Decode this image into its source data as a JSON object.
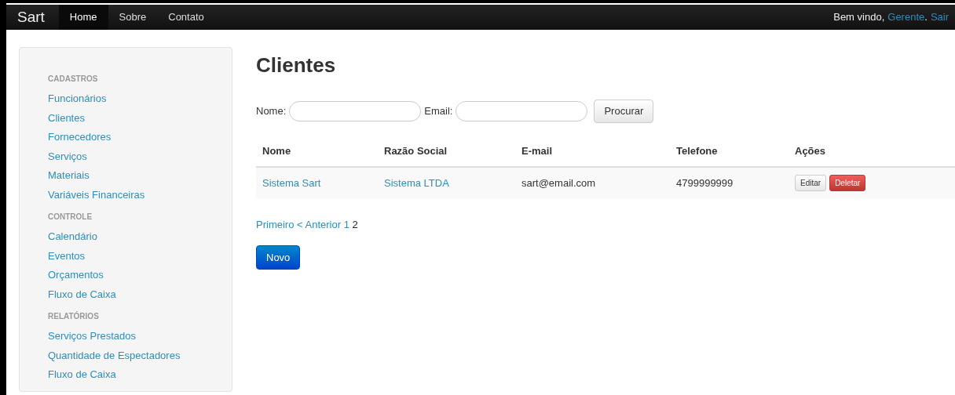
{
  "navbar": {
    "brand": "Sart",
    "items": [
      {
        "label": "Home",
        "selected": true
      },
      {
        "label": "Sobre",
        "selected": false
      },
      {
        "label": "Contato",
        "selected": false
      }
    ],
    "greeting": "Bem vindo,",
    "user": "Gerente",
    "separator": ".",
    "logout": "Sair"
  },
  "sidebar": {
    "sections": [
      {
        "header": "CADASTROS",
        "items": [
          "Funcionários",
          "Clientes",
          "Fornecedores",
          "Serviços",
          "Materiais",
          "Variáveis Financeiras"
        ]
      },
      {
        "header": "CONTROLE",
        "items": [
          "Calendário",
          "Eventos",
          "Orçamentos",
          "Fluxo de Caixa"
        ]
      },
      {
        "header": "RELATÓRIOS",
        "items": [
          "Serviços Prestados",
          "Quantidade de Espectadores",
          "Fluxo de Caixa"
        ]
      }
    ]
  },
  "page_title": "Clientes",
  "search": {
    "fields": [
      {
        "label": "Nome:"
      },
      {
        "label": "Email:"
      }
    ],
    "button": "Procurar"
  },
  "table": {
    "columns": [
      "Nome",
      "Razão Social",
      "E-mail",
      "Telefone",
      "Ações"
    ],
    "rows": [
      {
        "nome": "Sistema Sart",
        "razao_social": "Sistema LTDA",
        "email": "sart@email.com",
        "telefone": "4799999999",
        "actions": [
          "Editar",
          "Deletar"
        ]
      }
    ]
  },
  "pagination": {
    "first": "Primeiro",
    "previous": "< Anterior",
    "pages": [
      {
        "label": "1",
        "selected": false
      },
      {
        "label": "2",
        "selected": true
      }
    ]
  },
  "new_button": "Novo"
}
